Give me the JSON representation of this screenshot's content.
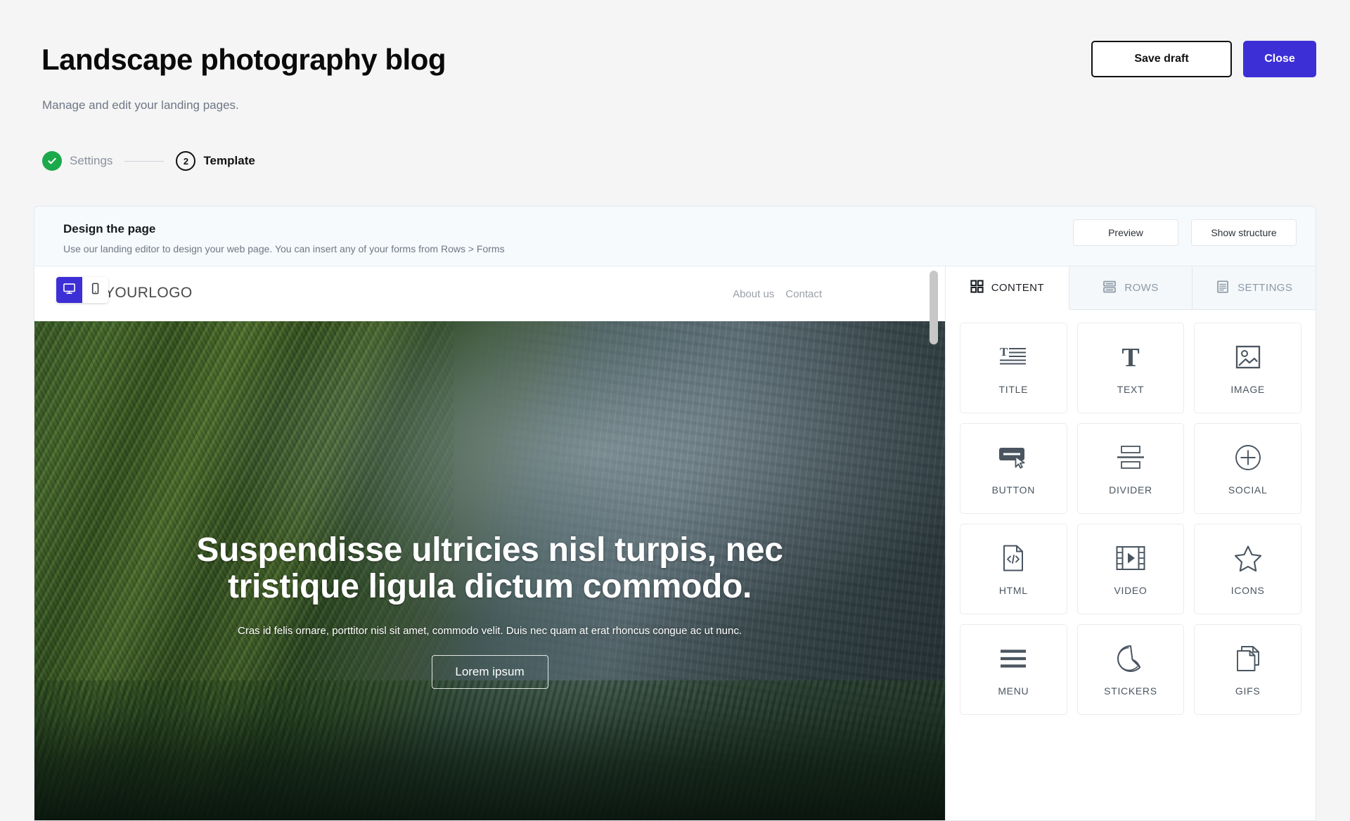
{
  "header": {
    "title": "Landscape photography blog",
    "subtitle": "Manage and edit your landing pages.",
    "save_draft_label": "Save draft",
    "close_label": "Close"
  },
  "stepper": {
    "steps": [
      {
        "label": "Settings",
        "state": "done",
        "marker": "check"
      },
      {
        "label": "Template",
        "state": "active",
        "marker": "2"
      }
    ]
  },
  "design_panel": {
    "title": "Design the page",
    "subtitle": "Use our landing editor to design your web page. You can insert any of your forms from Rows > Forms",
    "preview_label": "Preview",
    "show_structure_label": "Show structure"
  },
  "editor": {
    "device_toggle": {
      "desktop": {
        "icon": "desktop-icon",
        "active": true
      },
      "mobile": {
        "icon": "mobile-icon",
        "active": false
      },
      "active_color": "#3d2fd6"
    },
    "canvas": {
      "logo_text": "YOURLOGO",
      "nav": [
        {
          "label": "About us"
        },
        {
          "label": "Contact"
        }
      ],
      "hero": {
        "title": "Suspendisse ultricies nisl turpis, nec tristique ligula dictum commodo.",
        "subtitle": "Cras id felis ornare, porttitor nisl sit amet, commodo velit. Duis nec quam at erat rhoncus congue ac ut nunc.",
        "button_label": "Lorem ipsum",
        "image_description": "Misty green canyon with forested cliffs"
      }
    },
    "tabs": [
      {
        "label": "CONTENT",
        "icon": "grid-icon",
        "active": true
      },
      {
        "label": "ROWS",
        "icon": "rows-icon",
        "active": false
      },
      {
        "label": "SETTINGS",
        "icon": "settings-list-icon",
        "active": false
      }
    ],
    "content_tiles": [
      {
        "label": "TITLE",
        "icon": "title-icon"
      },
      {
        "label": "TEXT",
        "icon": "text-icon"
      },
      {
        "label": "IMAGE",
        "icon": "image-icon"
      },
      {
        "label": "BUTTON",
        "icon": "button-icon"
      },
      {
        "label": "DIVIDER",
        "icon": "divider-icon"
      },
      {
        "label": "SOCIAL",
        "icon": "social-plus-icon"
      },
      {
        "label": "HTML",
        "icon": "html-code-icon"
      },
      {
        "label": "VIDEO",
        "icon": "video-icon"
      },
      {
        "label": "ICONS",
        "icon": "star-icon"
      },
      {
        "label": "MENU",
        "icon": "menu-icon"
      },
      {
        "label": "STICKERS",
        "icon": "sticker-icon"
      },
      {
        "label": "GIFS",
        "icon": "gifs-icon"
      }
    ]
  },
  "colors": {
    "accent": "#3d2fd6",
    "success": "#1ca94c",
    "page_bg": "#f5f5f5",
    "panel_head_bg": "#f7fafc"
  }
}
